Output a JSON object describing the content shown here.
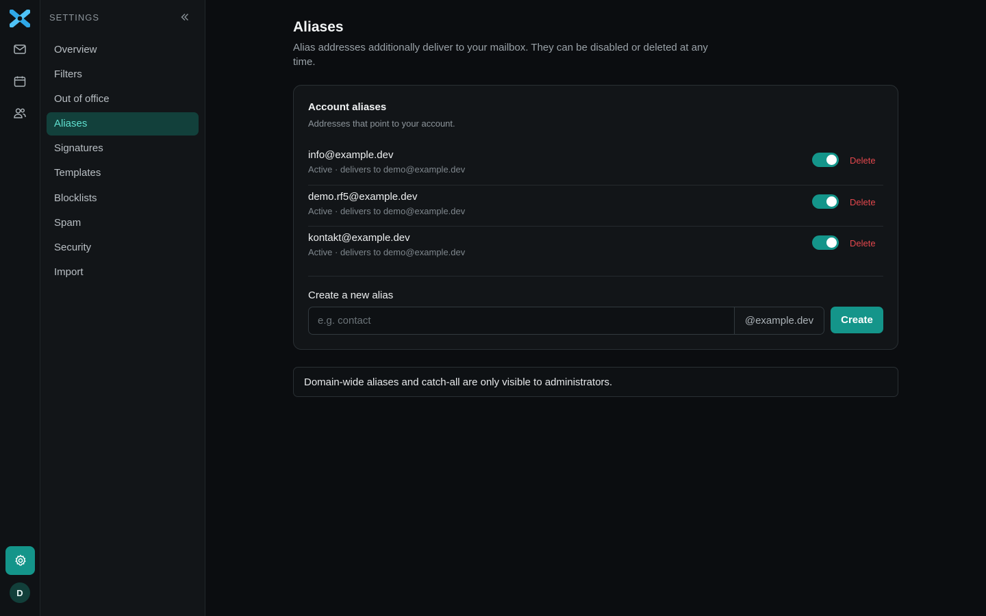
{
  "rail": {
    "logo_icon": "app-logo",
    "items": [
      {
        "icon": "mail-icon"
      },
      {
        "icon": "calendar-icon"
      },
      {
        "icon": "contacts-icon"
      }
    ],
    "settings_icon": "gear-icon",
    "avatar_initial": "D",
    "accent_color": "#14958a"
  },
  "sidebar": {
    "title": "SETTINGS",
    "collapse_icon": "chevrons-left-icon",
    "items": [
      {
        "label": "Overview"
      },
      {
        "label": "Filters"
      },
      {
        "label": "Out of office"
      },
      {
        "label": "Aliases",
        "active": true
      },
      {
        "label": "Signatures"
      },
      {
        "label": "Templates"
      },
      {
        "label": "Blocklists"
      },
      {
        "label": "Spam"
      },
      {
        "label": "Security"
      },
      {
        "label": "Import"
      }
    ]
  },
  "main": {
    "title": "Aliases",
    "description": "Alias addresses additionally deliver to your mailbox. They can be disabled or deleted at any time.",
    "card": {
      "title": "Account aliases",
      "subtitle": "Addresses that point to your account.",
      "aliases": [
        {
          "address": "info@example.dev",
          "meta": "Active · delivers to demo@example.dev",
          "enabled": true,
          "delete_label": "Delete"
        },
        {
          "address": "demo.rf5@example.dev",
          "meta": "Active · delivers to demo@example.dev",
          "enabled": true,
          "delete_label": "Delete"
        },
        {
          "address": "kontakt@example.dev",
          "meta": "Active · delivers to demo@example.dev",
          "enabled": true,
          "delete_label": "Delete"
        }
      ],
      "create": {
        "label": "Create a new alias",
        "placeholder": "e.g. contact",
        "value": "",
        "domain_suffix": "@example.dev",
        "button_label": "Create"
      }
    },
    "notice": "Domain-wide aliases and catch-all are only visible to administrators."
  }
}
